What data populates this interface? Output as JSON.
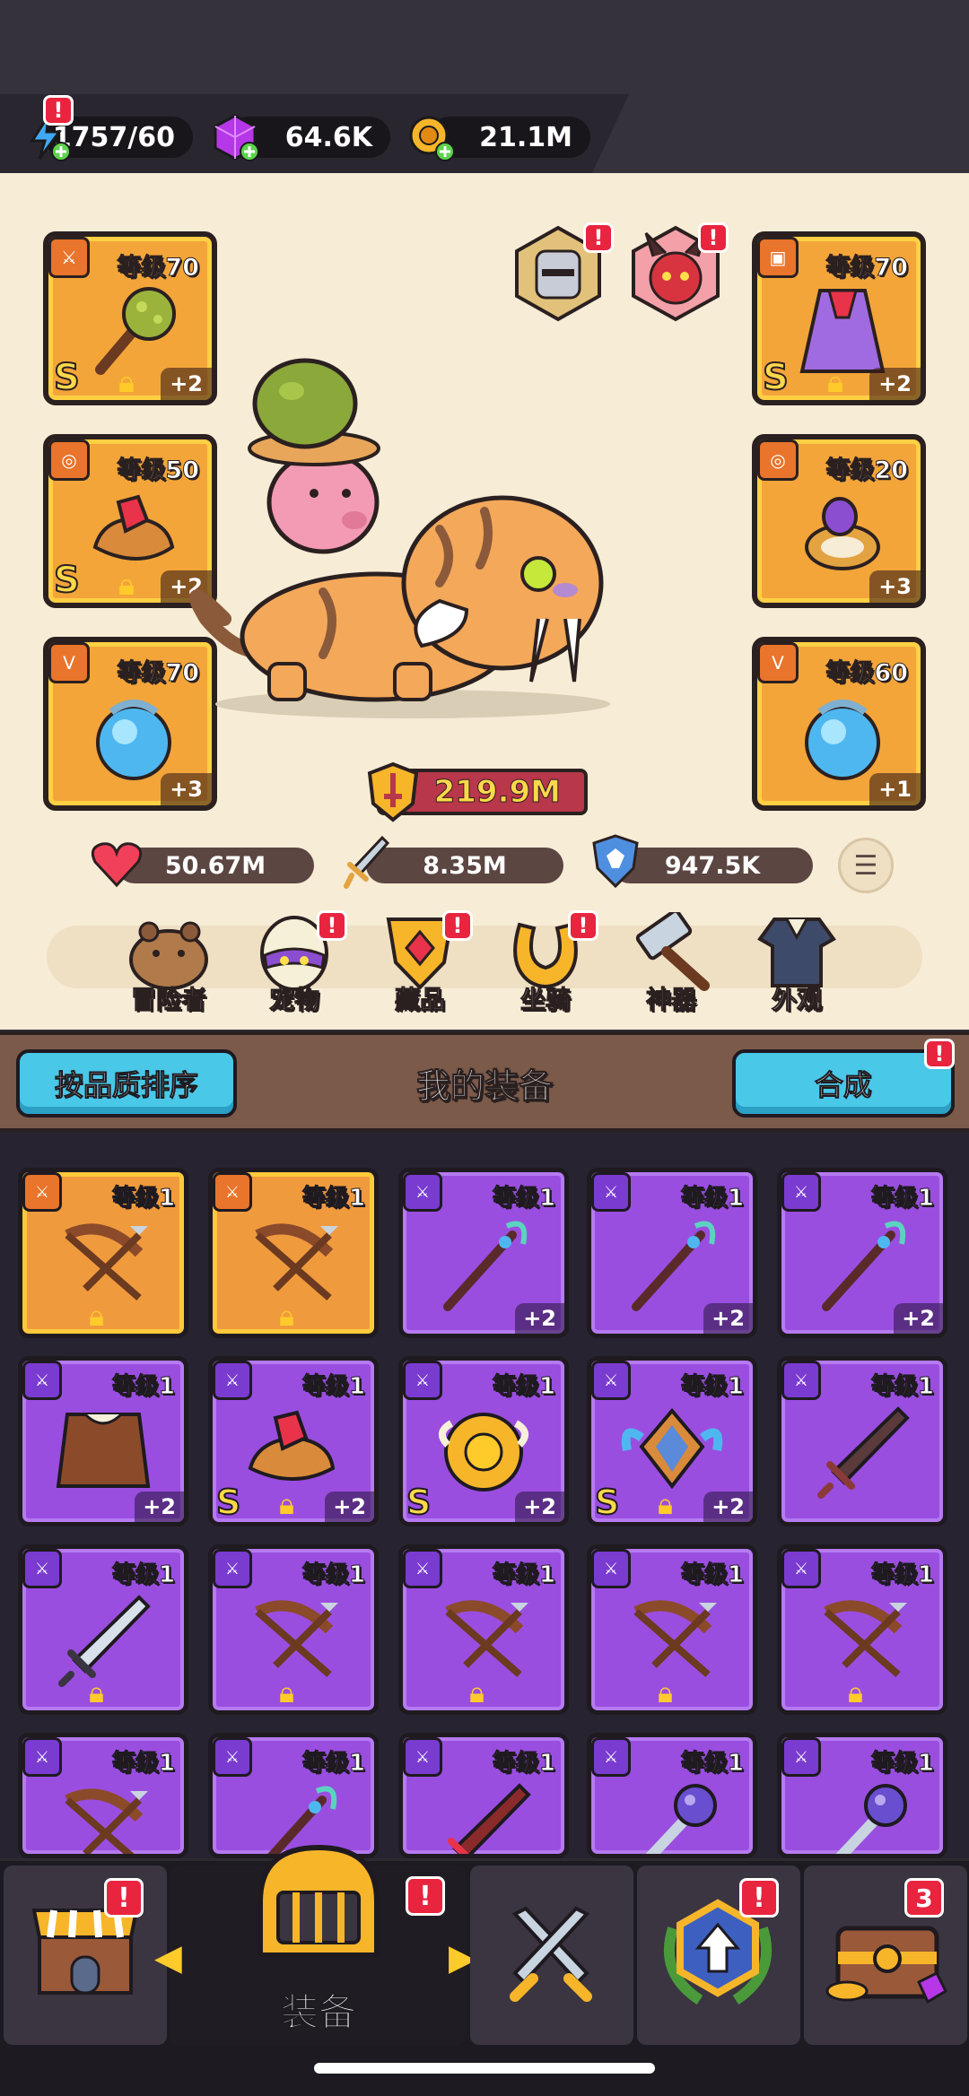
{
  "resources": {
    "energy": "1757/60",
    "gems": "64.6K",
    "coins": "21.1M"
  },
  "gear_left": [
    {
      "level": "等级70",
      "plus": "+2",
      "rank": "S",
      "locked": true,
      "slot_icon": "weapon-icon",
      "item": "spiked-club"
    },
    {
      "level": "等级50",
      "plus": "+2",
      "rank": "S",
      "locked": true,
      "slot_icon": "ring-slot-icon",
      "item": "ruby-gauntlet"
    },
    {
      "level": "等级70",
      "plus": "+3",
      "rank": "",
      "locked": false,
      "slot_icon": "necklace-slot-icon",
      "item": "blue-orb"
    }
  ],
  "gear_right": [
    {
      "level": "等级70",
      "plus": "+2",
      "rank": "S",
      "locked": true,
      "slot_icon": "armor-slot-icon",
      "item": "purple-cloak"
    },
    {
      "level": "等级20",
      "plus": "+3",
      "rank": "",
      "locked": false,
      "slot_icon": "ring-slot-icon",
      "item": "amethyst-ring"
    },
    {
      "level": "等级60",
      "plus": "+1",
      "rank": "",
      "locked": false,
      "slot_icon": "necklace-slot-icon",
      "item": "blue-orb"
    }
  ],
  "power": "219.9M",
  "stats": {
    "hp": "50.67M",
    "attack": "8.35M",
    "defense": "947.5K"
  },
  "menu": [
    {
      "label": "冒险者",
      "alert": false,
      "icon": "capybara-icon"
    },
    {
      "label": "宠物",
      "alert": true,
      "icon": "pet-egg-icon"
    },
    {
      "label": "藏品",
      "alert": true,
      "icon": "collection-icon"
    },
    {
      "label": "坐骑",
      "alert": true,
      "icon": "horseshoe-icon"
    },
    {
      "label": "神器",
      "alert": false,
      "icon": "hammer-icon"
    },
    {
      "label": "外观",
      "alert": false,
      "icon": "outfit-icon"
    }
  ],
  "equipment_header": {
    "sort_button": "按品质排序",
    "title": "我的装备",
    "merge_button": "合成"
  },
  "inventory": [
    {
      "tier": "orange",
      "level": "等级1",
      "plus": "",
      "rank": "",
      "locked": true,
      "item": "crossbow"
    },
    {
      "tier": "orange",
      "level": "等级1",
      "plus": "",
      "rank": "",
      "locked": true,
      "item": "crossbow"
    },
    {
      "tier": "purple",
      "level": "等级1",
      "plus": "+2",
      "rank": "",
      "locked": false,
      "item": "staff"
    },
    {
      "tier": "purple",
      "level": "等级1",
      "plus": "+2",
      "rank": "",
      "locked": false,
      "item": "staff"
    },
    {
      "tier": "purple",
      "level": "等级1",
      "plus": "+2",
      "rank": "",
      "locked": false,
      "item": "staff"
    },
    {
      "tier": "purple",
      "level": "等级1",
      "plus": "+2",
      "rank": "",
      "locked": false,
      "item": "leather-armor"
    },
    {
      "tier": "purple",
      "level": "等级1",
      "plus": "+2",
      "rank": "S",
      "locked": true,
      "item": "ruby-gauntlet"
    },
    {
      "tier": "purple",
      "level": "等级1",
      "plus": "+2",
      "rank": "S",
      "locked": false,
      "item": "sun-medal"
    },
    {
      "tier": "purple",
      "level": "等级1",
      "plus": "+2",
      "rank": "S",
      "locked": true,
      "item": "winged-crest"
    },
    {
      "tier": "purple",
      "level": "等级1",
      "plus": "",
      "rank": "",
      "locked": false,
      "item": "dark-sword"
    },
    {
      "tier": "purple",
      "level": "等级1",
      "plus": "",
      "rank": "",
      "locked": true,
      "item": "silver-sword"
    },
    {
      "tier": "purple",
      "level": "等级1",
      "plus": "",
      "rank": "",
      "locked": true,
      "item": "crossbow"
    },
    {
      "tier": "purple",
      "level": "等级1",
      "plus": "",
      "rank": "",
      "locked": true,
      "item": "crossbow"
    },
    {
      "tier": "purple",
      "level": "等级1",
      "plus": "",
      "rank": "",
      "locked": true,
      "item": "crossbow"
    },
    {
      "tier": "purple",
      "level": "等级1",
      "plus": "",
      "rank": "",
      "locked": true,
      "item": "crossbow"
    },
    {
      "tier": "purple",
      "level": "等级1",
      "plus": "",
      "rank": "",
      "locked": false,
      "item": "crossbow"
    },
    {
      "tier": "purple",
      "level": "等级1",
      "plus": "",
      "rank": "",
      "locked": false,
      "item": "staff"
    },
    {
      "tier": "purple",
      "level": "等级1",
      "plus": "",
      "rank": "",
      "locked": false,
      "item": "red-sword"
    },
    {
      "tier": "purple",
      "level": "等级1",
      "plus": "",
      "rank": "",
      "locked": false,
      "item": "mace"
    },
    {
      "tier": "purple",
      "level": "等级1",
      "plus": "",
      "rank": "",
      "locked": false,
      "item": "mace"
    }
  ],
  "bottom_nav": {
    "active_label": "装备",
    "chest_count": "3",
    "tabs": [
      {
        "icon": "shop-icon",
        "alert": true
      },
      {
        "icon": "helmet-icon",
        "alert": true
      },
      {
        "icon": "crossed-swords-icon",
        "alert": false
      },
      {
        "icon": "upgrade-icon",
        "alert": true
      },
      {
        "icon": "chest-icon",
        "alert": false
      }
    ]
  },
  "colors": {
    "orange_tier": "#f09a3e",
    "purple_tier": "#9a4ee0",
    "cyan_button": "#49c8e8",
    "alert_red": "#e8243f"
  }
}
